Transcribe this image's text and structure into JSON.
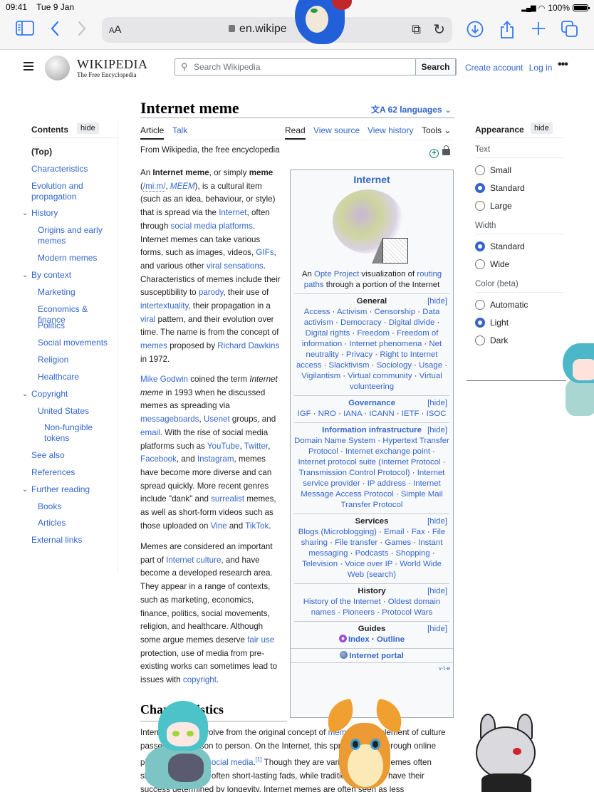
{
  "status_bar": {
    "time": "09:41",
    "date": "Tue 9 Jan",
    "battery": "100%"
  },
  "browser": {
    "text_size_label": "AA",
    "url": "en.wikipe",
    "icons": [
      "sidebar-icon",
      "back-icon",
      "forward-icon",
      "extension-icon",
      "reload-icon",
      "download-icon",
      "share-icon",
      "new-tab-icon",
      "tabs-icon"
    ]
  },
  "header": {
    "wordmark": "WIKIPEDIA",
    "tagline": "The Free Encyclopedia",
    "search_placeholder": "Search Wikipedia",
    "search_button": "Search",
    "create_account": "Create account",
    "log_in": "Log in",
    "more": "•••"
  },
  "toc": {
    "title": "Contents",
    "hide": "hide",
    "items": [
      {
        "label": "(Top)"
      },
      {
        "label": "Characteristics"
      },
      {
        "label": "Evolution and propagation"
      },
      {
        "label": "History",
        "expanded": true
      },
      {
        "label": "Origins and early memes"
      },
      {
        "label": "Modern memes"
      },
      {
        "label": "By context",
        "expanded": true
      },
      {
        "label": "Marketing"
      },
      {
        "label": "Economics & finance"
      },
      {
        "label": "Politics"
      },
      {
        "label": "Social movements"
      },
      {
        "label": "Religion"
      },
      {
        "label": "Healthcare"
      },
      {
        "label": "Copyright",
        "expanded": true
      },
      {
        "label": "United States"
      },
      {
        "label": "Non-fungible tokens"
      },
      {
        "label": "See also"
      },
      {
        "label": "References"
      },
      {
        "label": "Further reading",
        "expanded": true
      },
      {
        "label": "Books"
      },
      {
        "label": "Articles"
      },
      {
        "label": "External links"
      }
    ]
  },
  "article": {
    "title": "Internet meme",
    "languages": "62 languages",
    "tabs": {
      "article": "Article",
      "talk": "Talk",
      "read": "Read",
      "view_source": "View source",
      "view_history": "View history",
      "tools": "Tools"
    },
    "tagline": "From Wikipedia, the free encyclopedia",
    "p1": {
      "t1": "An ",
      "b1": "Internet meme",
      "t2": ", or simply ",
      "b2": "meme",
      "t3": " (",
      "ipa": "/miːm/",
      "t4": ", ",
      "meem": "MEEM",
      "t5": "), is a cultural item (such as an idea, behaviour, or style) that is spread via the ",
      "l_internet": "Internet",
      "t6": ", often through ",
      "l_smp": "social media platforms",
      "t7": ". Internet memes can take various forms, such as images, videos, ",
      "l_gifs": "GIFs",
      "t8": ", and various other ",
      "l_viral_sens": "viral sensations",
      "t9": ". Characteristics of memes include their susceptibility to ",
      "l_parody": "parody",
      "t10": ", their use of ",
      "l_intertext": "intertextuality",
      "t11": ", their propagation in a ",
      "l_viral": "viral",
      "t12": " pattern, and their evolution over time. The name is from the concept of ",
      "l_memes": "memes",
      "t13": " proposed by ",
      "l_dawkins": "Richard Dawkins",
      "t14": " in 1972."
    },
    "p2": {
      "l_godwin": "Mike Godwin",
      "t1": " coined the term ",
      "i1": "Internet meme",
      "t2": " in 1993 when he discussed memes as spreading via ",
      "l_msgboards": "messageboards",
      "t3": ", ",
      "l_usenet": "Usenet",
      "t4": " groups, and ",
      "l_email": "email",
      "t5": ". With the rise of social media platforms such as ",
      "l_youtube": "YouTube",
      "t6": ", ",
      "l_twitter": "Twitter",
      "t7": ", ",
      "l_facebook": "Facebook",
      "t8": ", and ",
      "l_instagram": "Instagram",
      "t9": ", memes have become more diverse and can spread quickly. More recent genres include \"dank\" and ",
      "l_surrealist": "surrealist",
      "t10": " memes, as well as short-form videos such as those uploaded on ",
      "l_vine": "Vine",
      "t11": " and ",
      "l_tiktok": "TikTok",
      "t12": "."
    },
    "p3": {
      "t1": "Memes are considered an important part of ",
      "l_culture": "Internet culture",
      "t2": ", and have become a developed research area. They appear in a range of contexts, such as marketing, economics, finance, politics, social movements, religion, and healthcare. Although some argue memes deserve ",
      "l_fairuse": "fair use",
      "t3": " protection, use of media from pre-existing works can sometimes lead to issues with ",
      "l_copyright": "copyright",
      "t4": "."
    },
    "section2_title": "Characteristics",
    "p4": {
      "t1": "Internet memes evolve from the original concept of ",
      "l_memes": "memes",
      "t2": " as an element of culture passed from person to person. On the Internet, this spread occurs through online platforms such as ",
      "l_social": "social media",
      "ref": "[1]",
      "t3": " Though they are varied, Internet memes often share that they are often short-lasting fads, while traditional memes have their success determined by longevity. Internet memes are often seen as less"
    }
  },
  "infobox": {
    "title": "Internet",
    "caption_t1": "An ",
    "caption_l1": "Opte Project",
    "caption_t2": " visualization of ",
    "caption_l2": "routing paths",
    "caption_t3": " through a portion of the Internet",
    "hide": "[hide]",
    "sections": [
      {
        "head": "General",
        "links": [
          "Access",
          "Activism",
          "Censorship",
          "Data activism",
          "Democracy",
          "Digital divide",
          "Digital rights",
          "Freedom",
          "Freedom of information",
          "Internet phenomena",
          "Net neutrality",
          "Privacy",
          "Right to Internet access",
          "Slacktivism",
          "Sociology",
          "Usage",
          "Vigilantism",
          "Virtual community",
          "Virtual volunteering"
        ]
      },
      {
        "head": "Governance",
        "links": [
          "IGF",
          "NRO",
          "IANA",
          "ICANN",
          "IETF",
          "ISOC"
        ]
      },
      {
        "head": "Information infrastructure",
        "links": [
          "Domain Name System",
          "Hypertext Transfer Protocol",
          "Internet exchange point",
          "Internet protocol suite (Internet Protocol",
          "Transmission Control Protocol)",
          "Internet service provider",
          "IP address",
          "Internet Message Access Protocol",
          "Simple Mail Transfer Protocol"
        ]
      },
      {
        "head": "Services",
        "links": [
          "Blogs (Microblogging)",
          "Email",
          "Fax",
          "File sharing",
          "File transfer",
          "Games",
          "Instant messaging",
          "Podcasts",
          "Shopping",
          "Television",
          "Voice over IP",
          "World Wide Web (search)"
        ]
      },
      {
        "head": "History",
        "links": [
          "History of the Internet",
          "Oldest domain names",
          "Pioneers",
          "Protocol Wars"
        ]
      },
      {
        "head": "Guides",
        "links": [
          "Index",
          "Outline"
        ]
      }
    ],
    "portal": "Internet portal",
    "vte": "v·t·e"
  },
  "appearance": {
    "title": "Appearance",
    "hide": "hide",
    "text_label": "Text",
    "text_options": [
      "Small",
      "Standard",
      "Large"
    ],
    "text_selected": "Standard",
    "width_label": "Width",
    "width_options": [
      "Standard",
      "Wide"
    ],
    "width_selected": "Standard",
    "color_label": "Color (beta)",
    "color_options": [
      "Automatic",
      "Light",
      "Dark"
    ],
    "color_selected": "Light"
  },
  "colors": {
    "link": "#3366cc",
    "text": "#202122",
    "ios_accent": "#3478f6",
    "radio_on": "#3366cc"
  }
}
